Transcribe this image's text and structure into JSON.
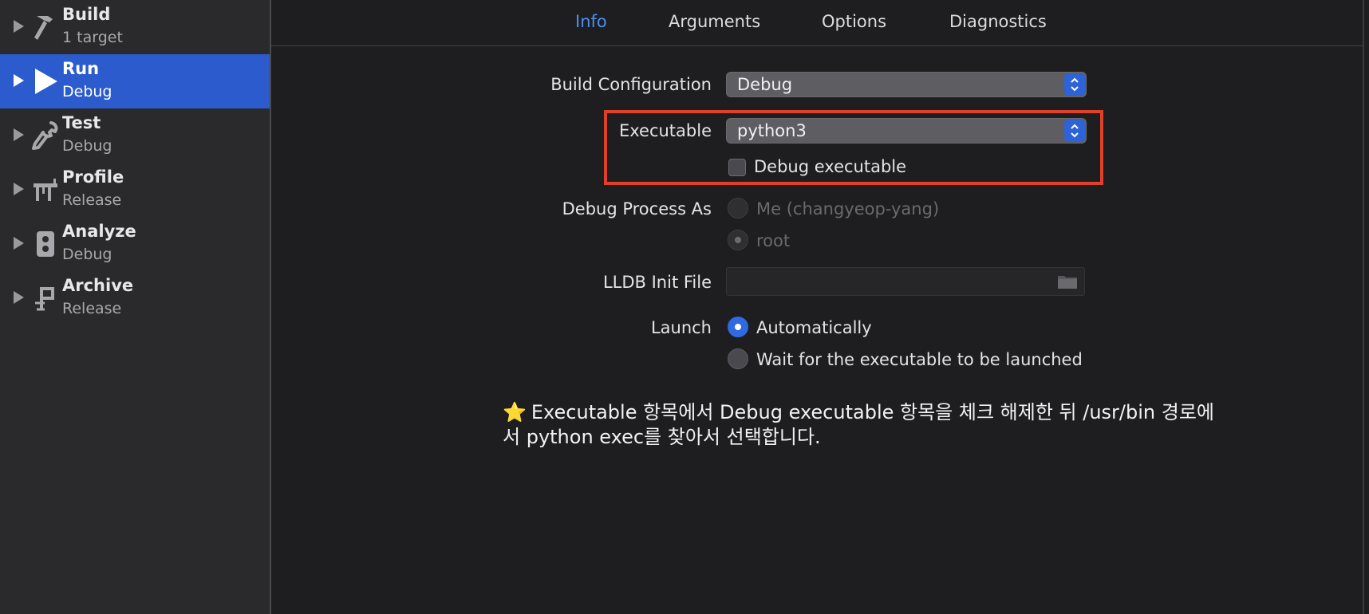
{
  "sidebar": {
    "items": [
      {
        "name": "Build",
        "sub": "1 target",
        "icon": "hammer-icon",
        "selected": false
      },
      {
        "name": "Run",
        "sub": "Debug",
        "icon": "play-icon",
        "selected": true
      },
      {
        "name": "Test",
        "sub": "Debug",
        "icon": "wrench-icon",
        "selected": false
      },
      {
        "name": "Profile",
        "sub": "Release",
        "icon": "gauge-icon",
        "selected": false
      },
      {
        "name": "Analyze",
        "sub": "Debug",
        "icon": "analyze-icon",
        "selected": false
      },
      {
        "name": "Archive",
        "sub": "Release",
        "icon": "archive-icon",
        "selected": false
      }
    ]
  },
  "tabs": [
    {
      "label": "Info",
      "active": true
    },
    {
      "label": "Arguments",
      "active": false
    },
    {
      "label": "Options",
      "active": false
    },
    {
      "label": "Diagnostics",
      "active": false
    }
  ],
  "form": {
    "build_configuration": {
      "label": "Build Configuration",
      "value": "Debug"
    },
    "executable": {
      "label": "Executable",
      "value": "python3"
    },
    "debug_executable": {
      "label": "Debug executable",
      "checked": false
    },
    "debug_process_as": {
      "label": "Debug Process As",
      "options": [
        {
          "label": "Me (changyeop-yang)",
          "selected": false,
          "disabled": true
        },
        {
          "label": "root",
          "selected": true,
          "disabled": true
        }
      ]
    },
    "lldb_init_file": {
      "label": "LLDB Init File",
      "value": ""
    },
    "launch": {
      "label": "Launch",
      "options": [
        {
          "label": "Automatically",
          "selected": true
        },
        {
          "label": "Wait for the executable to be launched",
          "selected": false
        }
      ]
    }
  },
  "note": {
    "star": "⭐",
    "text": "Executable 항목에서 Debug executable 항목을 체크 해제한 뒤 /usr/bin 경로에서 python exec를 찾아서 선택합니다."
  },
  "colors": {
    "accent": "#2b5bcc",
    "tab_active": "#4a90f0",
    "highlight": "#e0402a"
  }
}
